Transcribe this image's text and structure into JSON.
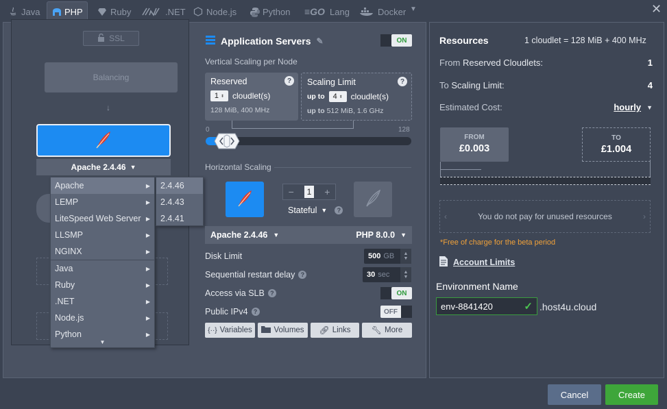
{
  "tabs": [
    {
      "label": "Java",
      "icon": "java-icon",
      "active": false
    },
    {
      "label": "PHP",
      "icon": "php-icon",
      "active": true
    },
    {
      "label": "Ruby",
      "icon": "ruby-icon",
      "active": false
    },
    {
      "label": ".NET",
      "icon": "dotnet-icon",
      "active": false
    },
    {
      "label": "Node.js",
      "icon": "nodejs-icon",
      "active": false
    },
    {
      "label": "Python",
      "icon": "python-icon",
      "active": false
    },
    {
      "label": "Lang",
      "icon": "go-icon",
      "active": false
    },
    {
      "label": "Docker",
      "icon": "docker-icon",
      "active": false
    }
  ],
  "topology": {
    "ssl_label": "SSL",
    "balancing_label": "Balancing",
    "node_label": "Apache 2.4.46"
  },
  "menu": {
    "items": [
      {
        "label": "Apache",
        "selected": true
      },
      {
        "label": "LEMP"
      },
      {
        "label": "LiteSpeed Web Server"
      },
      {
        "label": "LLSMP"
      },
      {
        "label": "NGINX"
      },
      {
        "label": "Java"
      },
      {
        "label": "Ruby"
      },
      {
        "label": ".NET"
      },
      {
        "label": "Node.js"
      },
      {
        "label": "Python"
      }
    ],
    "versions": [
      "2.4.46",
      "2.4.43",
      "2.4.41"
    ]
  },
  "app_servers": {
    "title": "Application Servers",
    "toggle": "ON",
    "vertical_label": "Vertical Scaling per Node",
    "reserved": {
      "title": "Reserved",
      "value": "1",
      "unit": "cloudlet(s)",
      "sub": "128 MiB, 400 MHz"
    },
    "limit": {
      "title": "Scaling Limit",
      "prefix": "up to",
      "value": "4",
      "unit": "cloudlet(s)",
      "sub_prefix": "up to",
      "sub": "512 MiB, 1.6 GHz"
    },
    "slider": {
      "min": "0",
      "max": "128",
      "reserved": 1,
      "limit": 4
    },
    "horizontal_label": "Horizontal Scaling",
    "node_count": "1",
    "mode": "Stateful",
    "server_select": "Apache 2.4.46",
    "php_select": "PHP 8.0.0",
    "disk_label": "Disk Limit",
    "disk_value": "500",
    "disk_unit": "GB",
    "restart_label": "Sequential restart delay",
    "restart_value": "30",
    "restart_unit": "sec",
    "slb_label": "Access via SLB",
    "slb_toggle": "ON",
    "ipv4_label": "Public IPv4",
    "ipv4_toggle": "OFF",
    "buttons": [
      "Variables",
      "Volumes",
      "Links",
      "More"
    ]
  },
  "resources": {
    "title": "Resources",
    "note": "1 cloudlet = 128 MiB + 400 MHz",
    "from_label": "From",
    "reserved_label": "Reserved Cloudlets:",
    "reserved_value": "1",
    "to_label": "To",
    "limit_label": "Scaling Limit:",
    "limit_value": "4",
    "cost_label": "Estimated Cost:",
    "cost_period": "hourly",
    "from_box_label": "FROM",
    "from_box_value": "£0.003",
    "to_box_label": "TO",
    "to_box_value": "£1.004",
    "unused_text": "You do not pay for unused resources",
    "beta_note": "*Free of charge for the beta period",
    "account_limits": "Account Limits",
    "env_label": "Environment Name",
    "env_value": "env-8841420",
    "env_suffix": ".host4u.cloud"
  },
  "footer": {
    "cancel": "Cancel",
    "create": "Create"
  },
  "colors": {
    "accent": "#1c8bf2",
    "create": "#3ea63a",
    "cancel": "#5a6d8a",
    "warning": "#f0a13a"
  }
}
